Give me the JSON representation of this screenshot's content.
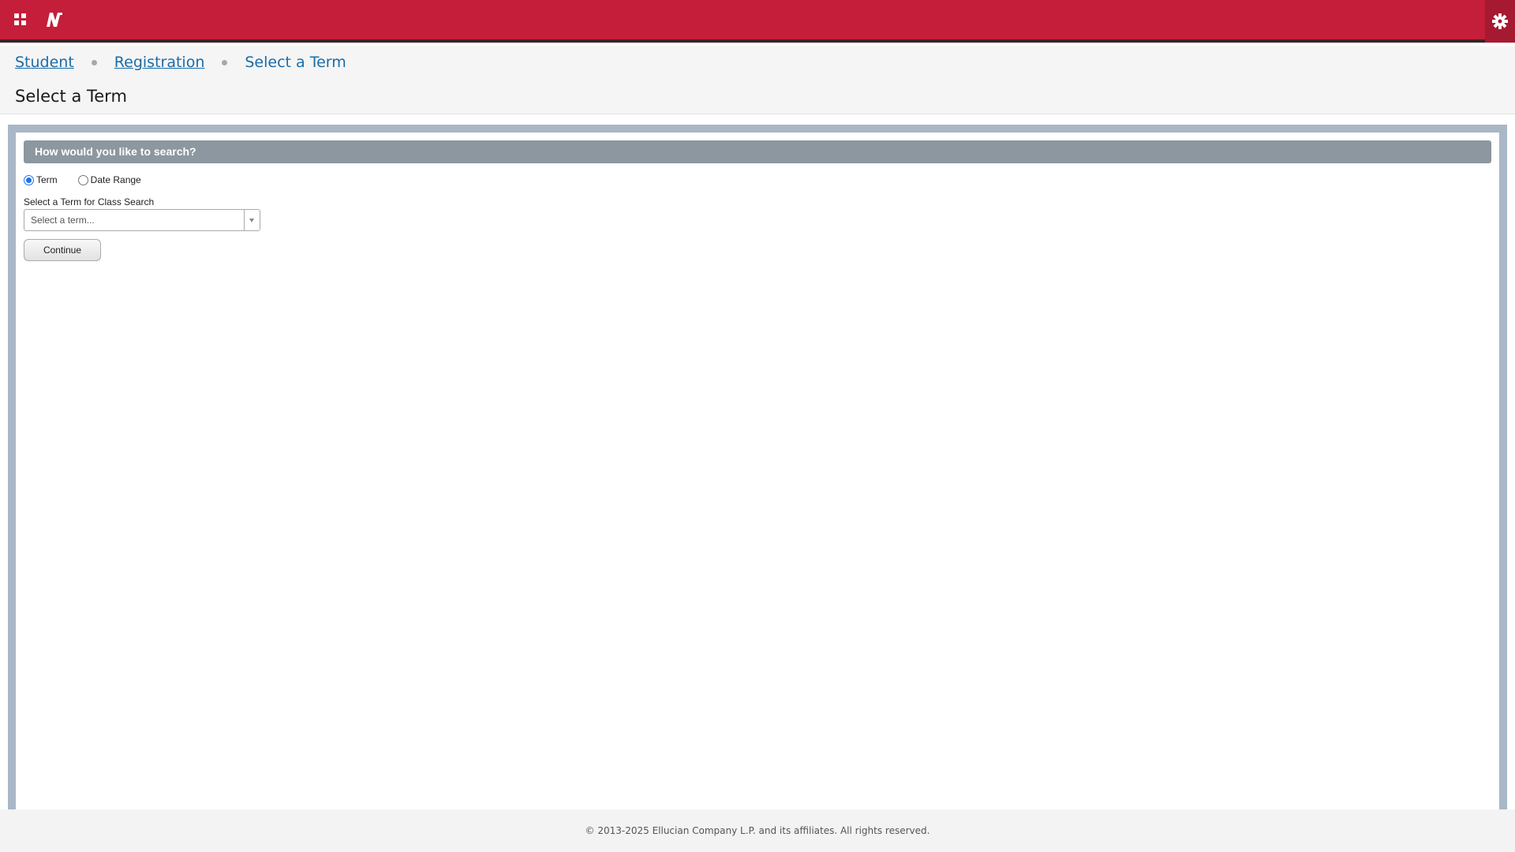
{
  "header": {
    "apps_icon": "grid-icon",
    "logo_icon": "n-logo-icon",
    "tools_icon": "gear-icon",
    "brand_color": "#c41e3a"
  },
  "breadcrumb": {
    "items": [
      {
        "label": "Student"
      },
      {
        "label": "Registration"
      },
      {
        "label": "Select a Term"
      }
    ]
  },
  "page": {
    "title": "Select a Term"
  },
  "search": {
    "section_title": "How would you like to search?",
    "options": [
      {
        "label": "Term",
        "checked": true
      },
      {
        "label": "Date Range",
        "checked": false
      }
    ],
    "term_field_label": "Select a Term for Class Search",
    "term_placeholder": "Select a term...",
    "continue_label": "Continue"
  },
  "footer": {
    "copyright": "© 2013-2025 Ellucian Company L.P. and its affiliates. All rights reserved."
  }
}
